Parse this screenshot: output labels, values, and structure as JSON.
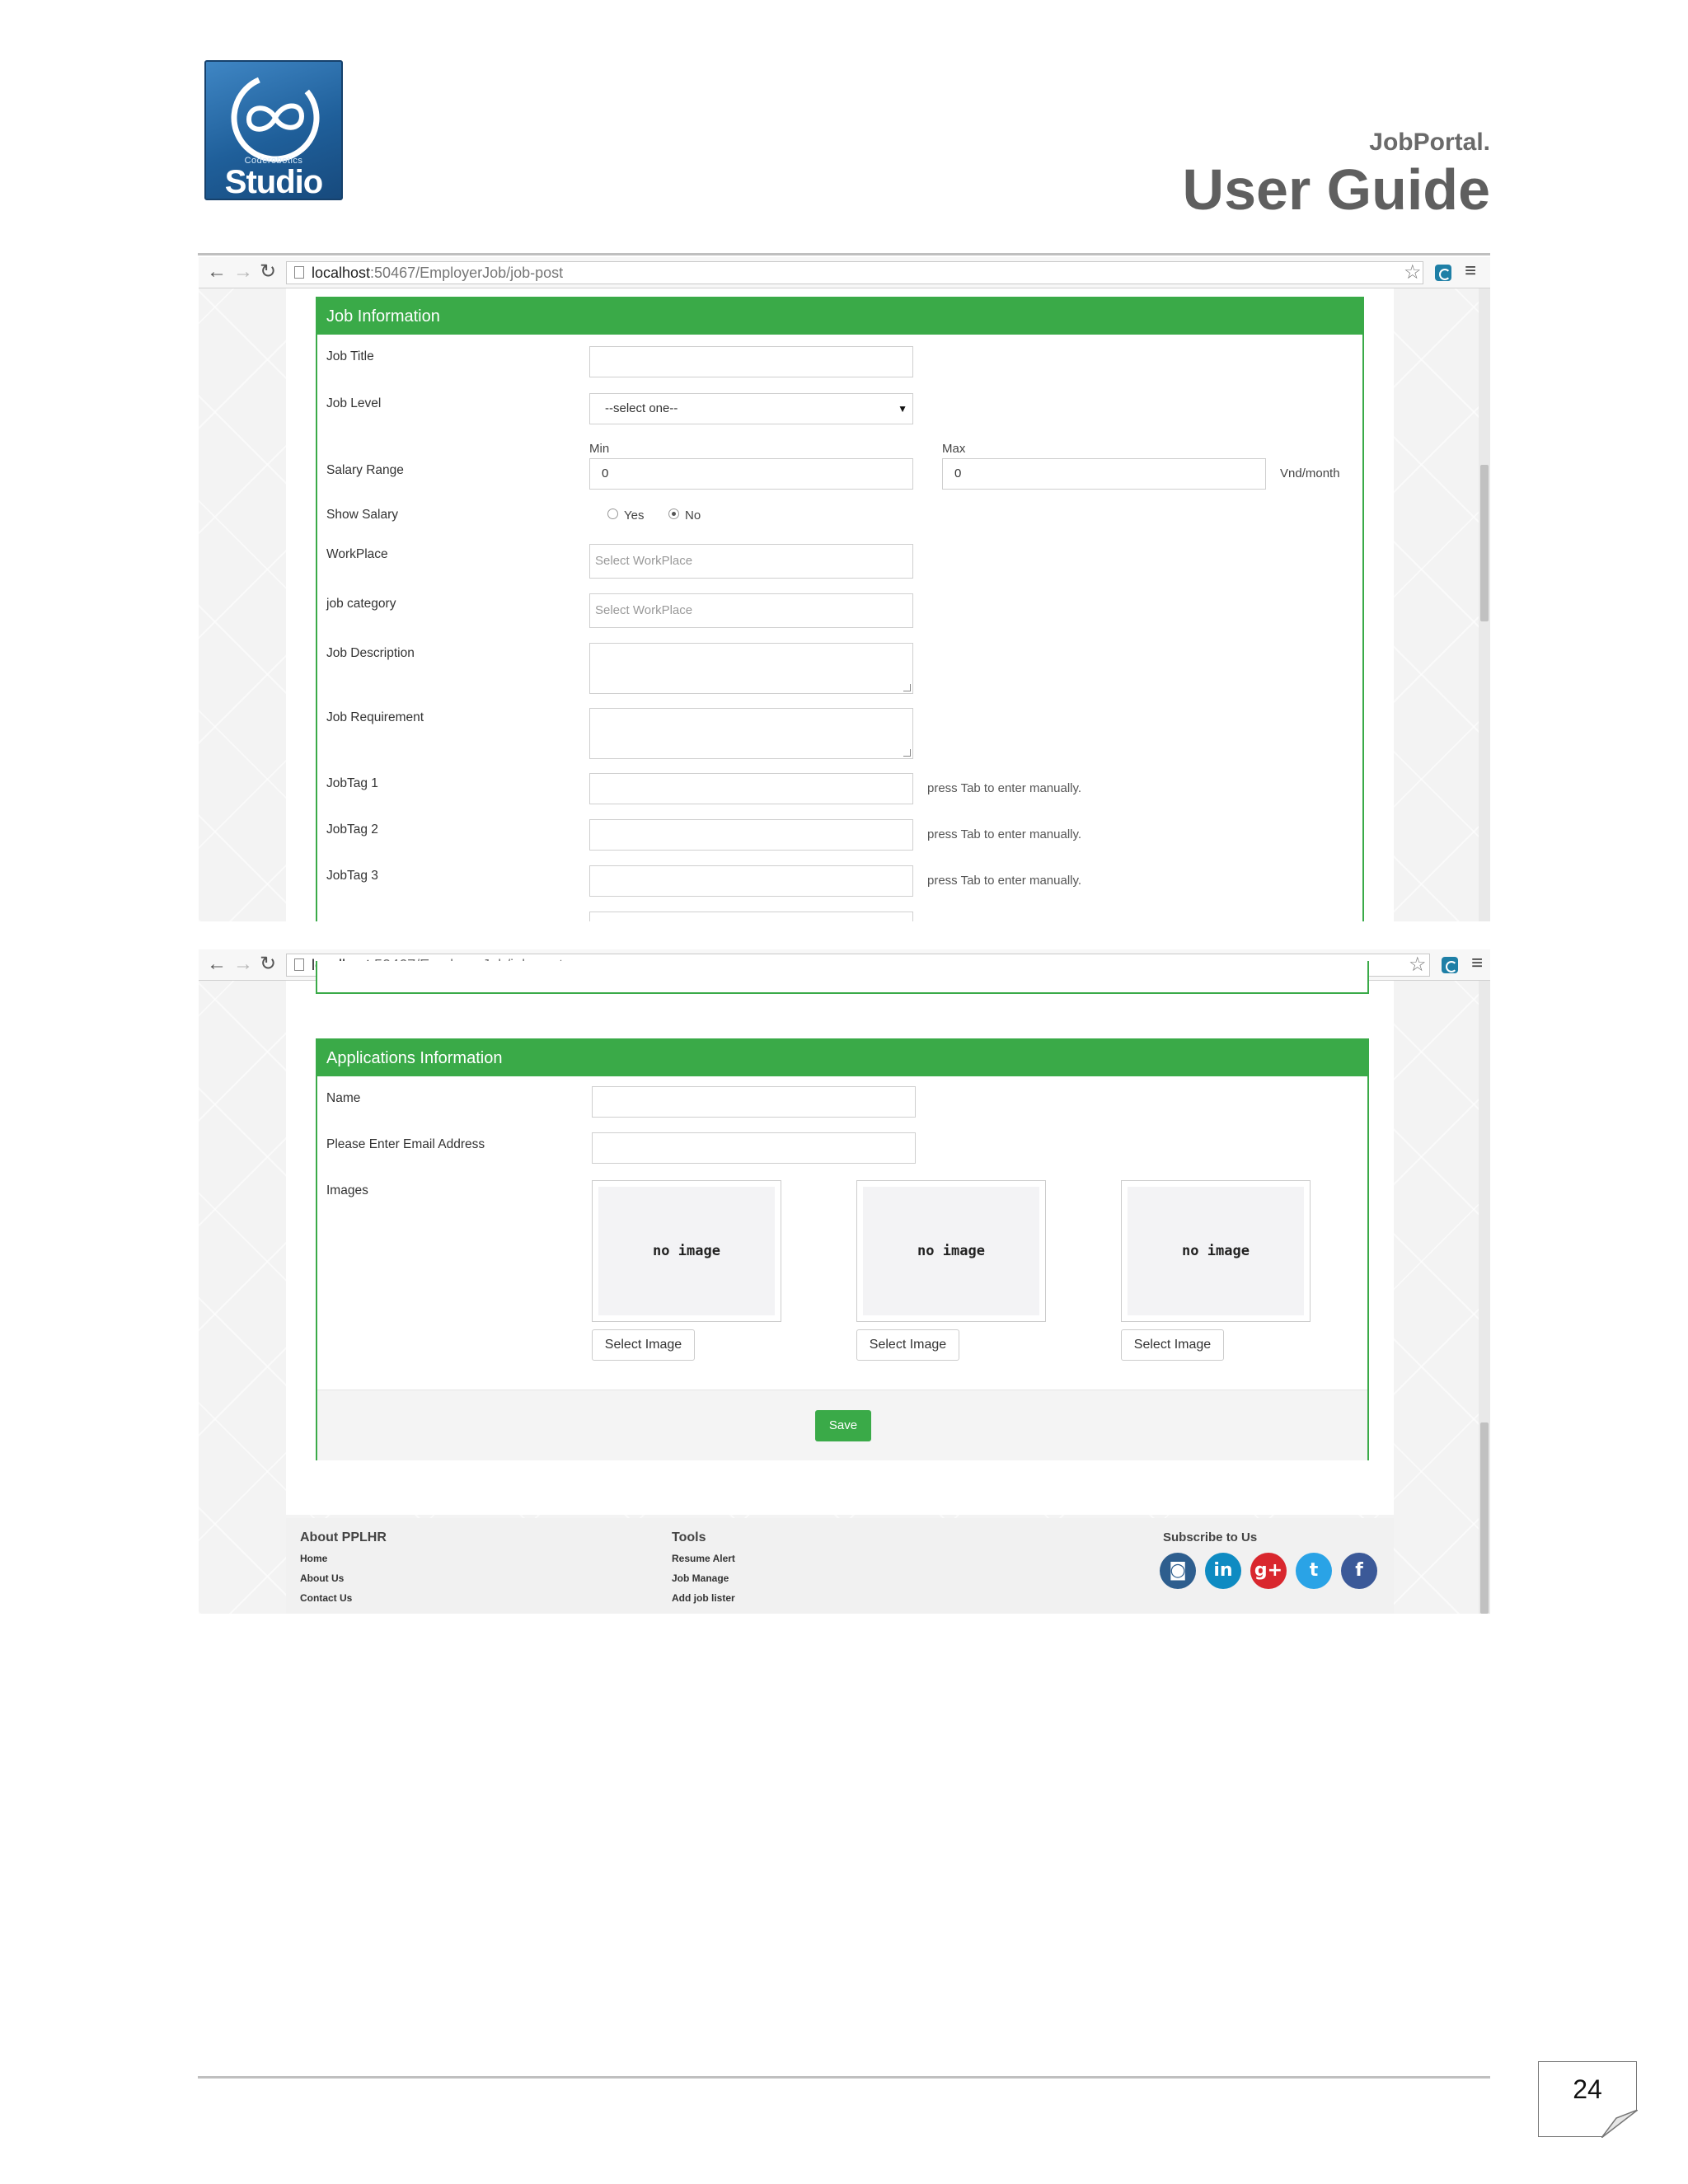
{
  "header": {
    "logo_small_text": "Coderobotics",
    "logo_big_text": "Studio",
    "brand": "JobPortal.",
    "title": "User Guide"
  },
  "browser": {
    "url_host": "localhost",
    "url_path": ":50467/EmployerJob/job-post"
  },
  "job_information": {
    "heading": "Job Information",
    "job_title_label": "Job Title",
    "job_title_value": "",
    "job_level_label": "Job Level",
    "job_level_selected": "--select one--",
    "salary_range_label": "Salary Range",
    "min_label": "Min",
    "max_label": "Max",
    "min_value": "0",
    "max_value": "0",
    "salary_unit": "Vnd/month",
    "show_salary_label": "Show Salary",
    "show_salary_options": [
      "Yes",
      "No"
    ],
    "show_salary_selected": "No",
    "workplace_label": "WorkPlace",
    "workplace_placeholder": "Select WorkPlace",
    "job_category_label": "job category",
    "job_category_placeholder": "Select WorkPlace",
    "job_description_label": "Job Description",
    "job_requirement_label": "Job Requirement",
    "tags": [
      {
        "label": "JobTag 1",
        "hint": "press Tab to enter manually."
      },
      {
        "label": "JobTag 2",
        "hint": "press Tab to enter manually."
      },
      {
        "label": "JobTag 3",
        "hint": "press Tab to enter manually."
      }
    ]
  },
  "applications_information": {
    "heading": "Applications Information",
    "name_label": "Name",
    "email_label": "Please Enter Email Address",
    "images_label": "Images",
    "images": [
      {
        "placeholder": "no image",
        "button": "Select Image"
      },
      {
        "placeholder": "no image",
        "button": "Select Image"
      },
      {
        "placeholder": "no image",
        "button": "Select Image"
      }
    ],
    "save_label": "Save"
  },
  "site_footer": {
    "about_heading": "About PPLHR",
    "about_links": [
      "Home",
      "About Us",
      "Contact Us"
    ],
    "tools_heading": "Tools",
    "tools_links": [
      "Resume Alert",
      "Job Manage",
      "Add job lister"
    ],
    "subscribe_heading": "Subscribe to Us",
    "social": [
      {
        "icon": "instagram-icon",
        "glyph": "◙",
        "color": "#2e5e8e"
      },
      {
        "icon": "linkedin-icon",
        "glyph": "in",
        "color": "#0e8bc2"
      },
      {
        "icon": "google-plus-icon",
        "glyph": "g+",
        "color": "#d9272e"
      },
      {
        "icon": "twitter-icon",
        "glyph": "t",
        "color": "#2aa3e6"
      },
      {
        "icon": "facebook-icon",
        "glyph": "f",
        "color": "#3b5998"
      }
    ]
  },
  "page_number": "24",
  "colors": {
    "accent_green": "#3aaa48",
    "title_gray": "#5f5f5f"
  }
}
